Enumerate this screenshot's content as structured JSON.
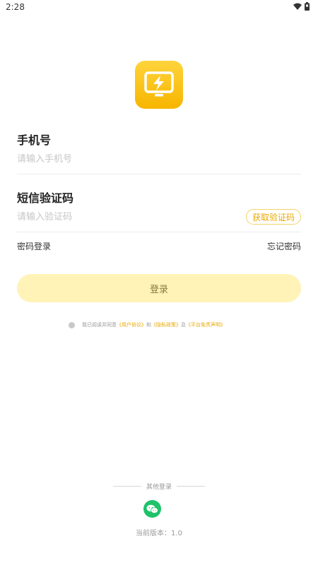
{
  "status_bar": {
    "time": "2:28",
    "wifi_icon": "wifi-icon",
    "battery_icon": "battery-icon"
  },
  "logo": {
    "icon": "power-monitor-icon",
    "color": "#f7b500"
  },
  "phone": {
    "label": "手机号",
    "placeholder": "请输入手机号",
    "value": ""
  },
  "code": {
    "label": "短信验证码",
    "placeholder": "请输入验证码",
    "value": "",
    "button": "获取验证码"
  },
  "links": {
    "password_login": "密码登录",
    "forgot_password": "忘记密码"
  },
  "login_button": "登录",
  "agreement": {
    "prefix": "我已阅读并同意",
    "user_agreement": "《用户协议》",
    "and": "和",
    "privacy_policy": "《隐私政策》",
    "and2": "及",
    "disclaimer": "《平台免责声明》"
  },
  "other_login": {
    "label": "其他登录",
    "wechat_icon": "wechat-icon"
  },
  "version": "当前版本：1.0",
  "colors": {
    "accent": "#e8a900",
    "login_bg": "#fff3b8",
    "wechat": "#20c26a"
  }
}
